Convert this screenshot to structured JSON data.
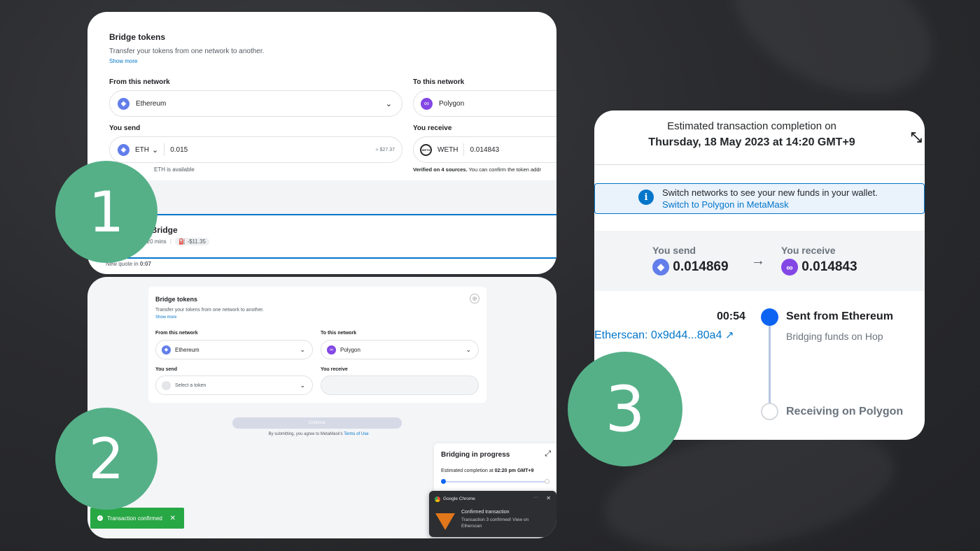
{
  "panel1": {
    "title": "Bridge tokens",
    "subtitle": "Transfer your tokens from one network to another.",
    "show_more": "Show more",
    "from_label": "From this network",
    "from_network": "Ethereum",
    "to_label": "To this network",
    "to_network": "Polygon",
    "send_label": "You send",
    "send_token": "ETH",
    "send_amount": "0.015",
    "send_fiat": "≈ $27.37",
    "available": "ETH is available",
    "receive_label": "You receive",
    "receive_token": "WETH",
    "receive_amount": "0.014843",
    "verified_bold": "Verified on 4 sources.",
    "verified_rest": " You can confirm the token addr",
    "quote_title": "p Bridge",
    "quote_time": "-20 mins",
    "quote_fee": "-$11.35",
    "new_quote_prefix": "New quote in ",
    "new_quote_time": "0:07"
  },
  "panel2": {
    "title": "Bridge tokens",
    "subtitle": "Transfer your tokens from one network to another.",
    "show_more": "Show more",
    "from_label": "From this network",
    "from_network": "Ethereum",
    "to_label": "To this network",
    "to_network": "Polygon",
    "send_label": "You send",
    "send_placeholder": "Select a token",
    "receive_label": "You receive",
    "continue": "Continue",
    "terms_prefix": "By submitting, you agree to MetaMask's ",
    "terms_link": "Terms of Use",
    "progress_title": "Bridging in progress",
    "progress_prefix": "Estimated completion at ",
    "progress_time": "02:20 pm GMT+9",
    "progress_fraction": 0.0,
    "chrome_app": "Google Chrome",
    "notif_title": "Confirmed transaction",
    "notif_body": "Transaction 3 confirmed! View on Etherscan",
    "toast": "Transaction confirmed"
  },
  "panel3": {
    "eta_label": "Estimated transaction completion on",
    "eta_date": "Thursday, 18 May 2023 at 14:20 GMT+9",
    "info_text": "Switch networks to see your new funds in your wallet.",
    "info_link": "Switch to Polygon in MetaMask",
    "send_label": "You send",
    "send_amount": "0.014869",
    "receive_label": "You receive",
    "receive_amount": "0.014843",
    "timer": "00:54",
    "etherscan": "Etherscan: 0x9d44...80a4",
    "step1_title": "Sent from Ethereum",
    "step1_sub": "Bridging funds on Hop",
    "step2_title": "Receiving on Polygon"
  },
  "badges": [
    "1",
    "2",
    "3"
  ],
  "icons": {
    "ethereum": "ethereum-icon",
    "polygon": "polygon-icon",
    "info": "info-icon",
    "expand": "expand-icon",
    "collapse": "collapse-icon",
    "external-link": "external-link-icon"
  },
  "colors": {
    "accent": "#0376c9",
    "badge": "#55b088",
    "success": "#28a745",
    "step_active": "#0e64f2"
  }
}
